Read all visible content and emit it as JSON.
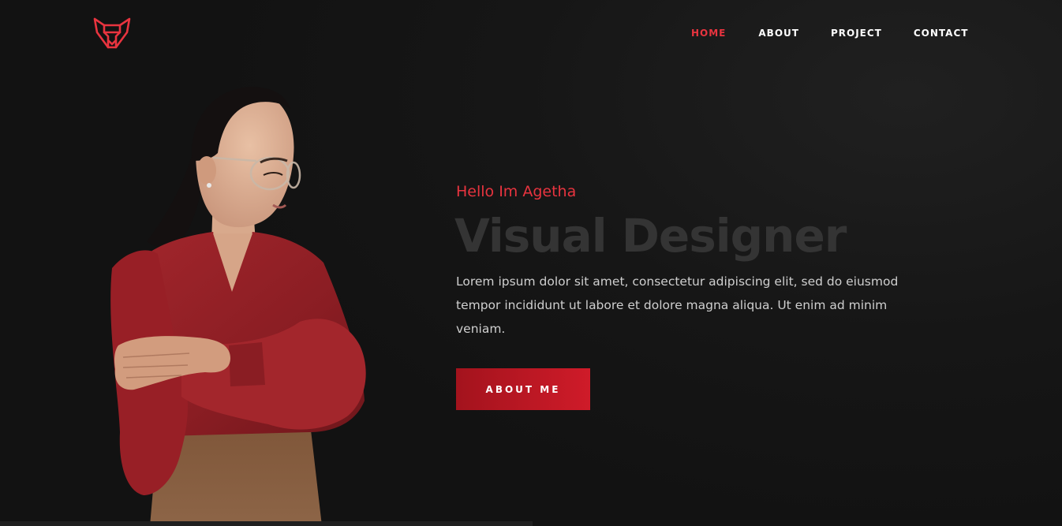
{
  "colors": {
    "accent": "#e8343f",
    "background": "#141414",
    "button": "#c01a26",
    "headline": "#343434",
    "body_text": "#cfcfcf"
  },
  "header": {
    "logo_icon": "fox-head-logo",
    "nav": [
      {
        "label": "HOME",
        "active": true
      },
      {
        "label": "ABOUT",
        "active": false
      },
      {
        "label": "PROJECT",
        "active": false
      },
      {
        "label": "CONTACT",
        "active": false
      }
    ]
  },
  "hero": {
    "greeting": "Hello Im Agetha",
    "headline": "Visual Designer",
    "description": "Lorem ipsum dolor sit amet, consectetur adipiscing elit, sed do eiusmod tempor incididunt ut labore et dolore magna aliqua. Ut enim ad minim veniam.",
    "button_label": "ABOUT ME",
    "image_icon": "woman-portrait-image"
  }
}
